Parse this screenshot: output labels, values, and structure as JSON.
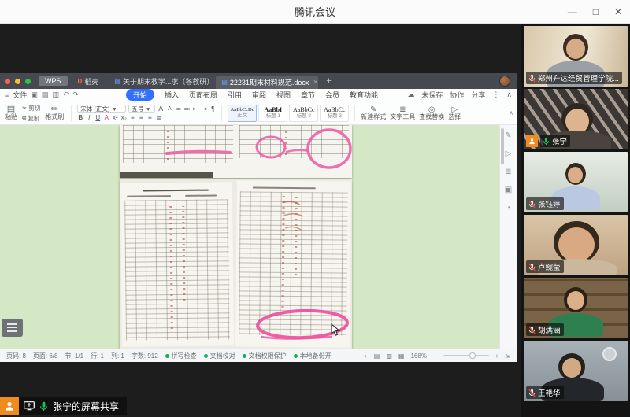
{
  "window": {
    "title": "腾讯会议"
  },
  "icons": {
    "minimize": "—",
    "maximize": "□",
    "close": "✕",
    "hamburger": "≡",
    "dropdown": "▾",
    "more_v": "⋮",
    "collapse": "∧",
    "cloud": "☁",
    "new_tab": "+",
    "tab_close": "✕",
    "doc": "▤",
    "quick": [
      "▣",
      "▤",
      "▥",
      "↶",
      "↷"
    ],
    "paste": "▤",
    "scissors": "✂",
    "copy": "⧉",
    "painter": "✏",
    "style_new": "✎",
    "text_tool": "≣",
    "find": "◎",
    "select": "▷",
    "rail": [
      "✎",
      "▷",
      "≣",
      "▣",
      "◔"
    ],
    "status_right": [
      "◐",
      "▤",
      "▥",
      "▦"
    ],
    "zoom_minus": "−",
    "zoom_plus": "+",
    "fullscreen": "⇲"
  },
  "wps": {
    "tabbar": {
      "home": "WPS",
      "tabs": [
        {
          "label": "稻壳",
          "icon": "D"
        },
        {
          "label": "关于期末教学...求（各教研）"
        },
        {
          "label": "22231期末材料规范.docx"
        }
      ]
    },
    "menu": {
      "file": "文件",
      "tabs": [
        "开始",
        "插入",
        "页面布局",
        "引用",
        "审阅",
        "视图",
        "章节",
        "会员",
        "教育功能"
      ],
      "right": [
        "未保存",
        "协作",
        "分享"
      ]
    },
    "ribbon": {
      "paste": "粘贴",
      "cut": "剪切",
      "copy": "复制",
      "painter": "格式刷",
      "font_family": "宋体 (正文)",
      "font_size": "五号",
      "font_buttons": [
        "B",
        "I",
        "U",
        "A",
        "x²",
        "x₂",
        "A",
        "A"
      ],
      "para_buttons": [
        "≔",
        "≕",
        "⇤",
        "⇥",
        "¶",
        "≡",
        "≡",
        "≡",
        "≣"
      ],
      "styles": [
        {
          "sample": "AaBbCcDd",
          "name": "正文"
        },
        {
          "sample": "AaBbI",
          "name": "标题 1"
        },
        {
          "sample": "AaBbCc",
          "name": "标题 2"
        },
        {
          "sample": "AaBbCc",
          "name": "标题 3"
        }
      ],
      "tools": [
        "新建样式",
        "文字工具",
        "查找替换",
        "选择"
      ]
    },
    "status": {
      "left": [
        "页码: 8",
        "页面: 6/8",
        "节: 1/1",
        "行: 1",
        "列: 1",
        "字数: 912"
      ],
      "checks": [
        "拼写检查",
        "文档校对",
        "文档权限保护",
        "本地备份开"
      ],
      "zoom": "168%"
    }
  },
  "meeting": {
    "share_banner": "张宁的屏幕共享",
    "participants": [
      {
        "name": "郑州升达经贸管理学院...",
        "mic": "muted"
      },
      {
        "name": "张宁",
        "mic": "on",
        "sharing": true
      },
      {
        "name": "张钰婷",
        "mic": "muted"
      },
      {
        "name": "卢婉莹",
        "mic": "muted"
      },
      {
        "name": "胡满涵",
        "mic": "muted"
      },
      {
        "name": "王艳华",
        "mic": "muted"
      }
    ]
  }
}
